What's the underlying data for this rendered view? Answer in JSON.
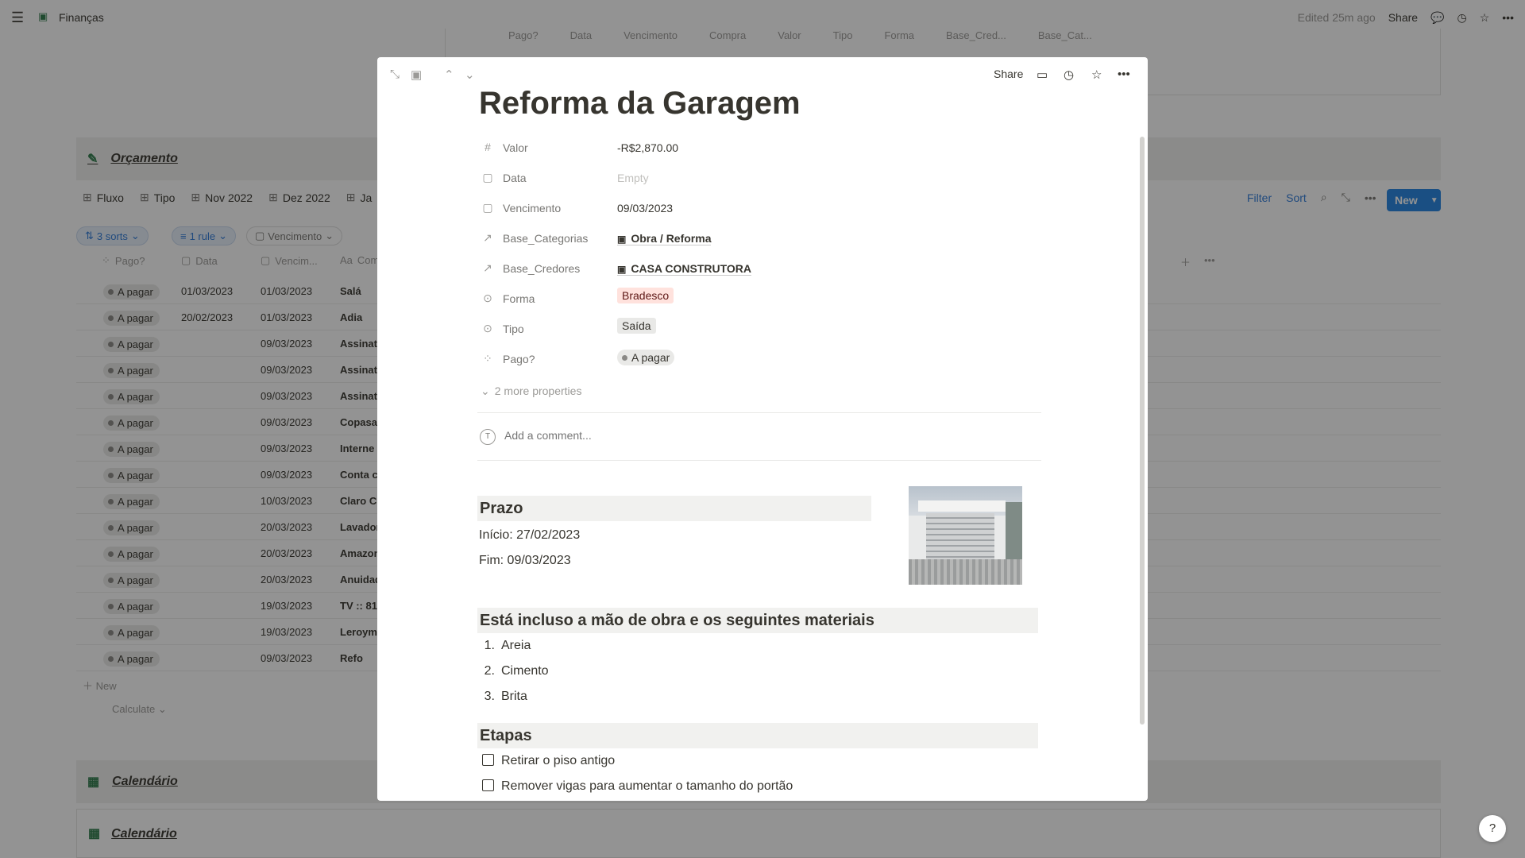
{
  "app": {
    "workspace_title": "Finanças",
    "edited": "Edited 25m ago",
    "share_label": "Share"
  },
  "background": {
    "top_columns": [
      "Pago?",
      "Data",
      "Vencimento",
      "Compra",
      "Valor",
      "Tipo",
      "Forma",
      "Base_Cred...",
      "Base_Cat..."
    ],
    "section_orcamento": "Orçamento",
    "views": [
      "Fluxo",
      "Tipo",
      "Nov 2022",
      "Dez 2022",
      "Ja"
    ],
    "toolbar": {
      "filter": "Filter",
      "sort": "Sort",
      "new": "New"
    },
    "chips": {
      "sorts": "3 sorts",
      "rule": "1 rule",
      "vencimento": "Vencimento"
    },
    "columns": {
      "pago": "Pago?",
      "data": "Data",
      "venc": "Vencim...",
      "compra": "Com"
    },
    "rows": [
      {
        "status": "A pagar",
        "data": "01/03/2023",
        "venc": "01/03/2023",
        "name": "Salá"
      },
      {
        "status": "A pagar",
        "data": "20/02/2023",
        "venc": "01/03/2023",
        "name": "Adia"
      },
      {
        "status": "A pagar",
        "data": "",
        "venc": "09/03/2023",
        "name": "Assinat"
      },
      {
        "status": "A pagar",
        "data": "",
        "venc": "09/03/2023",
        "name": "Assinat"
      },
      {
        "status": "A pagar",
        "data": "",
        "venc": "09/03/2023",
        "name": "Assinat"
      },
      {
        "status": "A pagar",
        "data": "",
        "venc": "09/03/2023",
        "name": "Copasa"
      },
      {
        "status": "A pagar",
        "data": "",
        "venc": "09/03/2023",
        "name": "Interne"
      },
      {
        "status": "A pagar",
        "data": "",
        "venc": "09/03/2023",
        "name": "Conta c"
      },
      {
        "status": "A pagar",
        "data": "",
        "venc": "10/03/2023",
        "name": "Claro C"
      },
      {
        "status": "A pagar",
        "data": "",
        "venc": "20/03/2023",
        "name": "Lavador"
      },
      {
        "status": "A pagar",
        "data": "",
        "venc": "20/03/2023",
        "name": "Amazon"
      },
      {
        "status": "A pagar",
        "data": "",
        "venc": "20/03/2023",
        "name": "Anuidad"
      },
      {
        "status": "A pagar",
        "data": "",
        "venc": "19/03/2023",
        "name": "TV :: 81"
      },
      {
        "status": "A pagar",
        "data": "",
        "venc": "19/03/2023",
        "name": "Leroym"
      },
      {
        "status": "A pagar",
        "data": "",
        "venc": "09/03/2023",
        "name": "Refo"
      }
    ],
    "new_row": "New",
    "calculate": "Calculate",
    "section_calendario1": "Calendário",
    "section_calendario2": "Calendário"
  },
  "modal": {
    "share_label": "Share",
    "title": "Reforma da Garagem",
    "properties": [
      {
        "icon": "#",
        "label": "Valor",
        "value": "-R$2,870.00",
        "kind": "text"
      },
      {
        "icon": "▢",
        "label": "Data",
        "value": "Empty",
        "kind": "empty"
      },
      {
        "icon": "▢",
        "label": "Vencimento",
        "value": "09/03/2023",
        "kind": "text"
      },
      {
        "icon": "↗",
        "label": "Base_Categorias",
        "value": "Obra / Reforma",
        "kind": "relation"
      },
      {
        "icon": "↗",
        "label": "Base_Credores",
        "value": "CASA CONSTRUTORA",
        "kind": "relation"
      },
      {
        "icon": "⊙",
        "label": "Forma",
        "value": "Bradesco",
        "kind": "select-red"
      },
      {
        "icon": "⊙",
        "label": "Tipo",
        "value": "Saída",
        "kind": "select-gray"
      },
      {
        "icon": "⁘",
        "label": "Pago?",
        "value": "A pagar",
        "kind": "status"
      }
    ],
    "more_properties": "2 more properties",
    "comment_placeholder": "Add a comment...",
    "prazo_heading": "Prazo",
    "inicio": "Início: 27/02/2023",
    "fim": "Fim: 09/03/2023",
    "materials_heading": "Está incluso a mão de obra e os seguintes materiais",
    "materials": [
      "Areia",
      "Cimento",
      "Brita"
    ],
    "etapas_heading": "Etapas",
    "etapas": [
      "Retirar o piso antigo",
      "Remover vigas para aumentar o tamanho do portão"
    ]
  },
  "help_label": "?"
}
